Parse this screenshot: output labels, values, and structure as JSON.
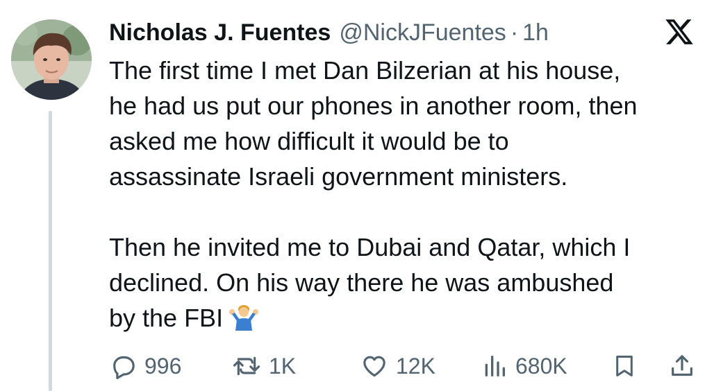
{
  "tweet": {
    "display_name": "Nicholas J. Fuentes",
    "handle": "@NickJFuentes",
    "separator": "·",
    "time": "1h",
    "paragraphs": [
      "The first time I met Dan Bilzerian at his house,\nhe had us put our phones in another room, then\nasked me how difficult it would be to\nassassinate Israeli government ministers.",
      "Then he invited me to Dubai and Qatar, which I\ndeclined. On his way there he was ambushed\nby the FBI"
    ],
    "emoji": "man-shrugging"
  },
  "actions": {
    "replies": "996",
    "reposts": "1K",
    "likes": "12K",
    "views": "680K"
  },
  "icons": {
    "reply": "reply-icon",
    "repost": "repost-icon",
    "like": "heart-icon",
    "views": "views-icon",
    "bookmark": "bookmark-icon",
    "share": "share-icon",
    "brand": "x-logo-icon"
  },
  "colors": {
    "text": "#0f1419",
    "secondary": "#536471",
    "thread_line": "#cfd9de"
  }
}
